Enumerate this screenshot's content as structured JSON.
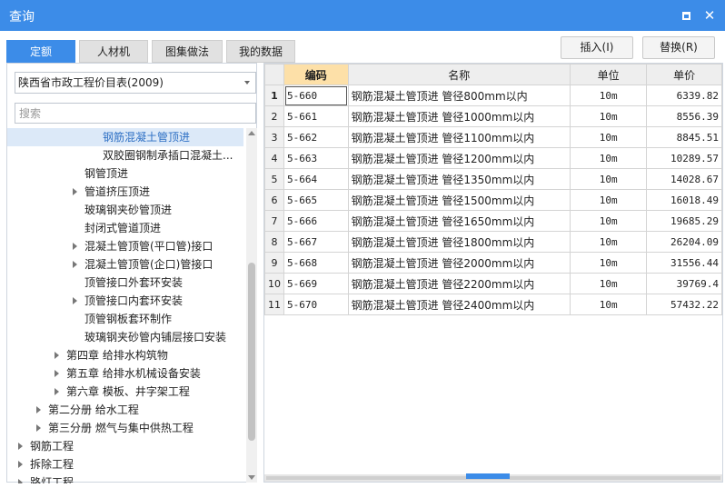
{
  "window": {
    "title": "查询",
    "maximize_icon": "maximize-icon",
    "close_icon": "close-icon",
    "close_glyph": "✕"
  },
  "tabs": [
    {
      "label": "定额",
      "active": true
    },
    {
      "label": "人材机",
      "active": false
    },
    {
      "label": "图集做法",
      "active": false
    },
    {
      "label": "我的数据",
      "active": false
    }
  ],
  "actions": {
    "insert_label": "插入(I)",
    "replace_label": "替换(R)"
  },
  "left": {
    "library_select": "陕西省市政工程价目表(2009)",
    "search_placeholder": "搜索",
    "tree": [
      {
        "label": "钢筋混凝土管顶进",
        "level": 5,
        "arrow": false,
        "selected": true
      },
      {
        "label": "双胶圈钢制承插口混凝土...",
        "level": 5,
        "arrow": false,
        "selected": false
      },
      {
        "label": "钢管顶进",
        "level": 4,
        "arrow": false,
        "selected": false
      },
      {
        "label": "管道挤压顶进",
        "level": 4,
        "arrow": true,
        "selected": false
      },
      {
        "label": "玻璃钢夹砂管顶进",
        "level": 4,
        "arrow": false,
        "selected": false
      },
      {
        "label": "封闭式管道顶进",
        "level": 4,
        "arrow": false,
        "selected": false
      },
      {
        "label": "混凝土管顶管(平口管)接口",
        "level": 4,
        "arrow": true,
        "selected": false
      },
      {
        "label": "混凝土管顶管(企口)管接口",
        "level": 4,
        "arrow": true,
        "selected": false
      },
      {
        "label": "顶管接口外套环安装",
        "level": 4,
        "arrow": false,
        "selected": false
      },
      {
        "label": "顶管接口内套环安装",
        "level": 4,
        "arrow": true,
        "selected": false
      },
      {
        "label": "顶管钢板套环制作",
        "level": 4,
        "arrow": false,
        "selected": false
      },
      {
        "label": "玻璃钢夹砂管内铺层接口安装",
        "level": 4,
        "arrow": false,
        "selected": false
      },
      {
        "label": "第四章 给排水构筑物",
        "level": 3,
        "arrow": true,
        "selected": false
      },
      {
        "label": "第五章 给排水机械设备安装",
        "level": 3,
        "arrow": true,
        "selected": false
      },
      {
        "label": "第六章 模板、井字架工程",
        "level": 3,
        "arrow": true,
        "selected": false
      },
      {
        "label": "第二分册 给水工程",
        "level": 2,
        "arrow": true,
        "selected": false
      },
      {
        "label": "第三分册 燃气与集中供热工程",
        "level": 2,
        "arrow": true,
        "selected": false
      },
      {
        "label": "钢筋工程",
        "level": 1,
        "arrow": true,
        "selected": false
      },
      {
        "label": "拆除工程",
        "level": 1,
        "arrow": true,
        "selected": false
      },
      {
        "label": "路灯工程",
        "level": 1,
        "arrow": true,
        "selected": false
      }
    ]
  },
  "grid": {
    "columns": [
      "编码",
      "名称",
      "单位",
      "单价"
    ],
    "rows": [
      {
        "no": "1",
        "code": "5-660",
        "name": "钢筋混凝土管顶进 管径800mm以内",
        "unit": "10m",
        "price": "6339.82"
      },
      {
        "no": "2",
        "code": "5-661",
        "name": "钢筋混凝土管顶进 管径1000mm以内",
        "unit": "10m",
        "price": "8556.39"
      },
      {
        "no": "3",
        "code": "5-662",
        "name": "钢筋混凝土管顶进 管径1100mm以内",
        "unit": "10m",
        "price": "8845.51"
      },
      {
        "no": "4",
        "code": "5-663",
        "name": "钢筋混凝土管顶进 管径1200mm以内",
        "unit": "10m",
        "price": "10289.57"
      },
      {
        "no": "5",
        "code": "5-664",
        "name": "钢筋混凝土管顶进 管径1350mm以内",
        "unit": "10m",
        "price": "14028.67"
      },
      {
        "no": "6",
        "code": "5-665",
        "name": "钢筋混凝土管顶进 管径1500mm以内",
        "unit": "10m",
        "price": "16018.49"
      },
      {
        "no": "7",
        "code": "5-666",
        "name": "钢筋混凝土管顶进 管径1650mm以内",
        "unit": "10m",
        "price": "19685.29"
      },
      {
        "no": "8",
        "code": "5-667",
        "name": "钢筋混凝土管顶进 管径1800mm以内",
        "unit": "10m",
        "price": "26204.09"
      },
      {
        "no": "9",
        "code": "5-668",
        "name": "钢筋混凝土管顶进 管径2000mm以内",
        "unit": "10m",
        "price": "31556.44"
      },
      {
        "no": "10",
        "code": "5-669",
        "name": "钢筋混凝土管顶进 管径2200mm以内",
        "unit": "10m",
        "price": "39769.4"
      },
      {
        "no": "11",
        "code": "5-670",
        "name": "钢筋混凝土管顶进 管径2400mm以内",
        "unit": "10m",
        "price": "57432.22"
      }
    ]
  },
  "colors": {
    "accent": "#3c8ce8",
    "selected_row_bg": "#dce9f8",
    "active_header_bg": "#fde0a8"
  }
}
